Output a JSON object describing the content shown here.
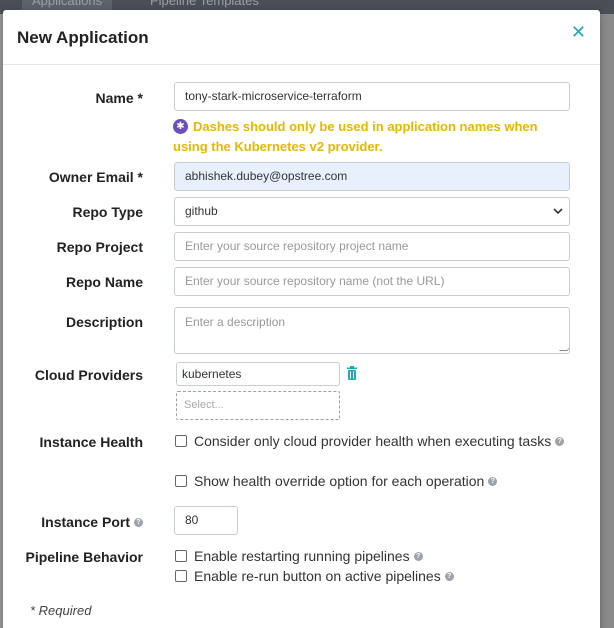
{
  "backdrop": {
    "tabs": [
      "Applications",
      "Pipeline Templates"
    ]
  },
  "modal": {
    "title": "New Application",
    "close_icon": "close-icon"
  },
  "form": {
    "name": {
      "label": "Name *",
      "value": "tony-stark-microservice-terraform"
    },
    "name_warning": "Dashes should only be used in application names when using the Kubernetes v2 provider.",
    "owner_email": {
      "label": "Owner Email *",
      "value": "abhishek.dubey@opstree.com"
    },
    "repo_type": {
      "label": "Repo Type",
      "value": "github"
    },
    "repo_project": {
      "label": "Repo Project",
      "placeholder": "Enter your source repository project name"
    },
    "repo_name": {
      "label": "Repo Name",
      "placeholder": "Enter your source repository name (not the URL)"
    },
    "description": {
      "label": "Description",
      "placeholder": "Enter a description"
    },
    "cloud_providers": {
      "label": "Cloud Providers",
      "selected": "kubernetes",
      "select_placeholder": "Select..."
    },
    "instance_health": {
      "label": "Instance Health",
      "options": [
        {
          "label": "Consider only cloud provider health when executing tasks",
          "checked": false
        },
        {
          "label": "Show health override option for each operation",
          "checked": false
        }
      ]
    },
    "instance_port": {
      "label": "Instance Port",
      "value": "80"
    },
    "pipeline_behavior": {
      "label": "Pipeline Behavior",
      "options": [
        {
          "label": "Enable restarting running pipelines",
          "checked": false
        },
        {
          "label": "Enable re-run button on active pipelines",
          "checked": false
        }
      ]
    },
    "required_note": "* Required"
  },
  "colors": {
    "accent": "#1fa8b8",
    "warning": "#e6b800",
    "kubernetes": "#6b4fbb"
  }
}
